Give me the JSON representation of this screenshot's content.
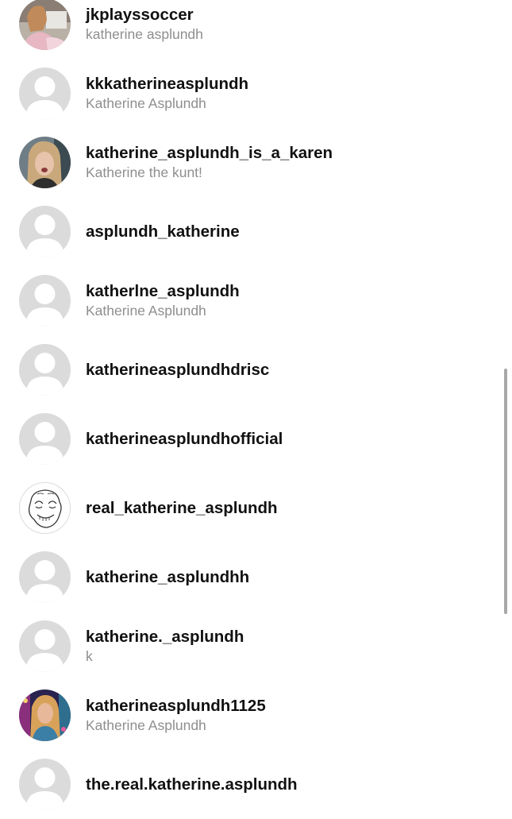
{
  "results": [
    {
      "username": "jkplayssoccer",
      "full_name": "katherine asplundh",
      "avatar": "photo-avatar"
    },
    {
      "username": "kkkatherineasplundh",
      "full_name": "Katherine Asplundh",
      "avatar": "default-avatar"
    },
    {
      "username": "katherine_asplundh_is_a_karen",
      "full_name": "Katherine the kunt!",
      "avatar": "photo-avatar"
    },
    {
      "username": "asplundh_katherine",
      "full_name": "",
      "avatar": "default-avatar"
    },
    {
      "username": "katherlne_asplundh",
      "full_name": "Katherine Asplundh",
      "avatar": "default-avatar"
    },
    {
      "username": "katherineasplundhdrisc",
      "full_name": "",
      "avatar": "default-avatar"
    },
    {
      "username": "katherineasplundhofficial",
      "full_name": "",
      "avatar": "default-avatar"
    },
    {
      "username": "real_katherine_asplundh",
      "full_name": "",
      "avatar": "meme-face-avatar"
    },
    {
      "username": "katherine_asplundhh",
      "full_name": "",
      "avatar": "default-avatar"
    },
    {
      "username": "katherine._asplundh",
      "full_name": "k",
      "avatar": "default-avatar"
    },
    {
      "username": "katherineasplundh1125",
      "full_name": "Katherine Asplundh",
      "avatar": "photo-avatar"
    },
    {
      "username": "the.real.katherine.asplundh",
      "full_name": "",
      "avatar": "default-avatar"
    }
  ],
  "colors": {
    "username": "#111111",
    "full_name": "#8e8e8e",
    "default_avatar_bg": "#dbdbdb",
    "scrollbar": "#a8a8a8"
  }
}
